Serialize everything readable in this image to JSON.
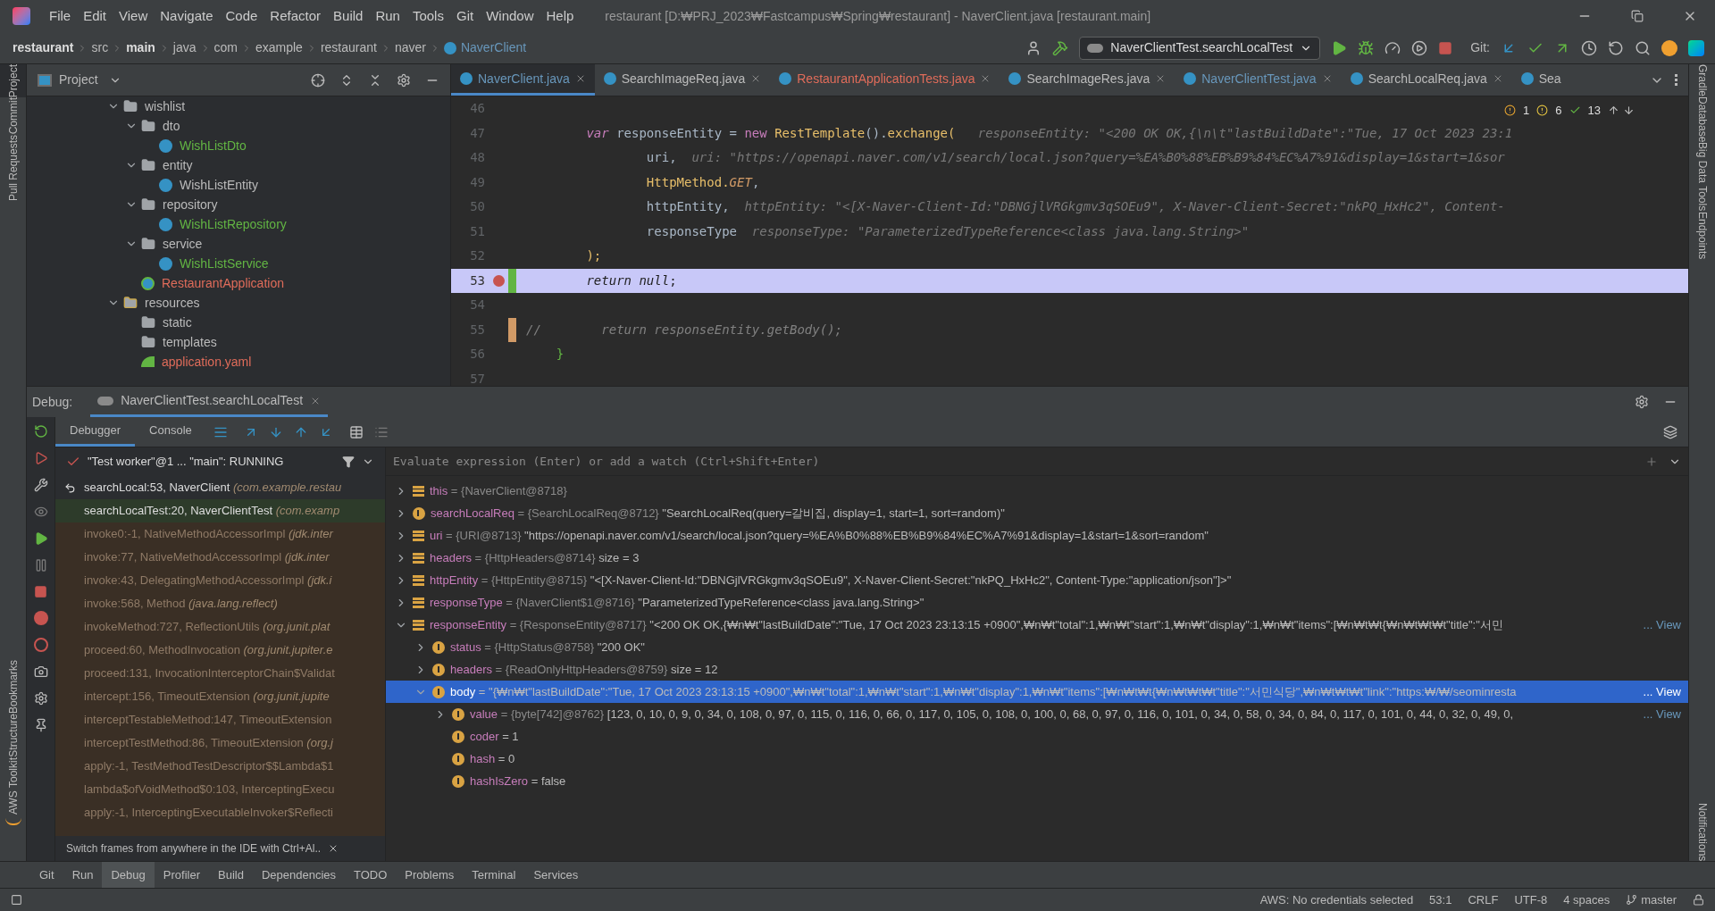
{
  "window": {
    "title": "restaurant [D:₩PRJ_2023₩Fastcampus₩Spring₩restaurant] - NaverClient.java [restaurant.main]"
  },
  "menu": [
    "File",
    "Edit",
    "View",
    "Navigate",
    "Code",
    "Refactor",
    "Build",
    "Run",
    "Tools",
    "Git",
    "Window",
    "Help"
  ],
  "breadcrumbs": [
    {
      "label": "restaurant",
      "bold": true
    },
    {
      "label": "src",
      "bold": false
    },
    {
      "label": "main",
      "bold": true
    },
    {
      "label": "java",
      "bold": false
    },
    {
      "label": "com",
      "bold": false
    },
    {
      "label": "example",
      "bold": false
    },
    {
      "label": "restaurant",
      "bold": false
    },
    {
      "label": "naver",
      "bold": false
    },
    {
      "label": "NaverClient",
      "bold": false,
      "kind": "class"
    }
  ],
  "run_config": "NaverClientTest.searchLocalTest",
  "git_label": "Git:",
  "left_strip": [
    "Project",
    "Commit",
    "Pull Requests",
    "Bookmarks",
    "Structure",
    "AWS Toolkit"
  ],
  "right_strip": [
    "Gradle",
    "Database",
    "Big Data Tools",
    "Endpoints",
    "Notifications"
  ],
  "project_panel": {
    "title": "Project",
    "tree": [
      {
        "name": "wishlist",
        "kind": "folder",
        "expanded": true,
        "children": [
          {
            "name": "dto",
            "kind": "package",
            "expanded": true,
            "children": [
              {
                "name": "WishListDto",
                "kind": "class",
                "color": "#62b543"
              }
            ]
          },
          {
            "name": "entity",
            "kind": "package",
            "expanded": true,
            "children": [
              {
                "name": "WishListEntity",
                "kind": "class",
                "color": "#bbbbbb"
              }
            ]
          },
          {
            "name": "repository",
            "kind": "package",
            "expanded": true,
            "children": [
              {
                "name": "WishListRepository",
                "kind": "class",
                "color": "#62b543"
              }
            ]
          },
          {
            "name": "service",
            "kind": "package",
            "expanded": true,
            "children": [
              {
                "name": "WishListService",
                "kind": "class",
                "color": "#62b543"
              }
            ]
          },
          {
            "name": "RestaurantApplication",
            "kind": "app",
            "color": "#e06c5a"
          }
        ]
      },
      {
        "name": "resources",
        "kind": "resources",
        "expanded": true,
        "children": [
          {
            "name": "static",
            "kind": "folder",
            "color": "#bbbbbb"
          },
          {
            "name": "templates",
            "kind": "folder",
            "color": "#bbbbbb"
          },
          {
            "name": "application.yaml",
            "kind": "yaml",
            "color": "#e06c5a"
          }
        ]
      }
    ]
  },
  "editor_tabs": [
    {
      "label": "NaverClient.java",
      "selected": true,
      "color": "#6897bb"
    },
    {
      "label": "SearchImageReq.java",
      "selected": false,
      "color": "#bbbbbb"
    },
    {
      "label": "RestaurantApplicationTests.java",
      "selected": false,
      "color": "#e06c5a"
    },
    {
      "label": "SearchImageRes.java",
      "selected": false,
      "color": "#bbbbbb"
    },
    {
      "label": "NaverClientTest.java",
      "selected": false,
      "color": "#6897bb"
    },
    {
      "label": "SearchLocalReq.java",
      "selected": false,
      "color": "#bbbbbb"
    },
    {
      "label": "Sea",
      "selected": false,
      "color": "#bbbbbb"
    }
  ],
  "inspections": {
    "errors": "1",
    "warnings": "6",
    "ok": "13"
  },
  "code": [
    {
      "number": "46",
      "current": false
    },
    {
      "number": "47",
      "current": false,
      "segments": [
        {
          "t": "        var",
          "kind": "kw"
        },
        {
          "t": " responseEntity = ",
          "kind": "plain"
        },
        {
          "t": "new ",
          "kind": "kw2"
        },
        {
          "t": "RestTemplate",
          "kind": "cls"
        },
        {
          "t": "().",
          "kind": "plain"
        },
        {
          "t": "exchange(",
          "kind": "method"
        },
        {
          "t": "   responseEntity: \"<200 OK OK,{\\n\\t\"lastBuildDate\":\"Tue, 17 Oct 2023 23:1",
          "kind": "hint"
        }
      ]
    },
    {
      "number": "48",
      "current": false,
      "segments": [
        {
          "t": "                uri,",
          "kind": "plain"
        },
        {
          "t": "  uri: \"https://openapi.naver.com/v1/search/local.json?query=%EA%B0%88%EB%B9%84%EC%A7%91&display=1&start=1&sor",
          "kind": "hint"
        }
      ]
    },
    {
      "number": "49",
      "current": false,
      "segments": [
        {
          "t": "                HttpMethod.",
          "kind": "cls"
        },
        {
          "t": "GET",
          "kind": "enum"
        },
        {
          "t": ",",
          "kind": "plain"
        }
      ]
    },
    {
      "number": "50",
      "current": false,
      "segments": [
        {
          "t": "                httpEntity,",
          "kind": "plain"
        },
        {
          "t": "  httpEntity: \"<[X-Naver-Client-Id:\"DBNGjlVRGkgmv3qSOEu9\", X-Naver-Client-Secret:\"nkPQ_HxHc2\", Content-",
          "kind": "hint"
        }
      ]
    },
    {
      "number": "51",
      "current": false,
      "segments": [
        {
          "t": "                responseType",
          "kind": "plain"
        },
        {
          "t": "  responseType: \"ParameterizedTypeReference<class java.lang.String>\"",
          "kind": "hint"
        }
      ]
    },
    {
      "number": "52",
      "current": false,
      "segments": [
        {
          "t": "        );",
          "kind": "method"
        }
      ]
    },
    {
      "number": "53",
      "current": true,
      "breakpoint": true,
      "color": "#62b543",
      "segments": [
        {
          "t": "        return null",
          "kind": "kw"
        },
        {
          "t": ";",
          "kind": "plain"
        }
      ]
    },
    {
      "number": "54",
      "current": false
    },
    {
      "number": "55",
      "current": false,
      "color": "#d19a66",
      "segments": [
        {
          "t": "//        return responseEntity.getBody();",
          "kind": "comment"
        }
      ]
    },
    {
      "number": "56",
      "current": false,
      "segments": [
        {
          "t": "    }",
          "kind": "brace"
        }
      ]
    },
    {
      "number": "57",
      "current": false
    }
  ],
  "debug": {
    "title": "Debug:",
    "session": "NaverClientTest.searchLocalTest",
    "tabs": [
      {
        "label": "Debugger",
        "selected": true
      },
      {
        "label": "Console",
        "selected": false
      }
    ],
    "thread": "\"Test worker\"@1 ... \"main\": RUNNING",
    "frames": [
      {
        "method": "searchLocal:53, NaverClient",
        "package": "(com.example.restau",
        "kind": "current"
      },
      {
        "method": "searchLocalTest:20, NaverClientTest",
        "package": "(com.examp",
        "kind": "selected"
      },
      {
        "method": "invoke0:-1, NativeMethodAccessorImpl",
        "package": "(jdk.inter",
        "kind": "library"
      },
      {
        "method": "invoke:77, NativeMethodAccessorImpl",
        "package": "(jdk.inter",
        "kind": "library"
      },
      {
        "method": "invoke:43, DelegatingMethodAccessorImpl",
        "package": "(jdk.i",
        "kind": "library"
      },
      {
        "method": "invoke:568, Method",
        "package": "(java.lang.reflect)",
        "kind": "library"
      },
      {
        "method": "invokeMethod:727, ReflectionUtils",
        "package": "(org.junit.plat",
        "kind": "library"
      },
      {
        "method": "proceed:60, MethodInvocation",
        "package": "(org.junit.jupiter.e",
        "kind": "library"
      },
      {
        "method": "proceed:131, InvocationInterceptorChain$Validat",
        "kind": "library"
      },
      {
        "method": "intercept:156, TimeoutExtension",
        "package": "(org.junit.jupite",
        "kind": "library"
      },
      {
        "method": "interceptTestableMethod:147, TimeoutExtension",
        "kind": "library"
      },
      {
        "method": "interceptTestMethod:86, TimeoutExtension",
        "package": "(org.j",
        "kind": "library"
      },
      {
        "method": "apply:-1, TestMethodTestDescriptor$$Lambda$1",
        "kind": "library"
      },
      {
        "method": "lambda$ofVoidMethod$0:103, InterceptingExecu",
        "kind": "library"
      },
      {
        "method": "apply:-1, InterceptingExecutableInvoker$Reflecti",
        "kind": "library"
      }
    ],
    "hint": "Switch frames from anywhere in the IDE with Ctrl+Al..",
    "evaluate_placeholder": "Evaluate expression (Enter) or add a watch (Ctrl+Shift+Enter)",
    "variables": [
      {
        "kind": "local",
        "name": "this",
        "type": "= {NaverClient@8718}",
        "expanded": false,
        "selected": false
      },
      {
        "kind": "param",
        "name": "searchLocalReq",
        "type": "= {SearchLocalReq@8712}",
        "value": "\"SearchLocalReq(query=갈비집, display=1, start=1, sort=random)\"",
        "expanded": false,
        "selected": false
      },
      {
        "kind": "local",
        "name": "uri",
        "type": "= {URI@8713}",
        "value": "\"https://openapi.naver.com/v1/search/local.json?query=%EA%B0%88%EB%B9%84%EC%A7%91&display=1&start=1&sort=random\"",
        "expanded": false,
        "selected": false
      },
      {
        "kind": "local",
        "name": "headers",
        "type": "= {HttpHeaders@8714}",
        "extra": "size = 3",
        "expanded": false,
        "selected": false
      },
      {
        "kind": "local",
        "name": "httpEntity",
        "type": "= {HttpEntity@8715}",
        "value": "\"<[X-Naver-Client-Id:\"DBNGjlVRGkgmv3qSOEu9\", X-Naver-Client-Secret:\"nkPQ_HxHc2\", Content-Type:\"application/json\"]>\"",
        "expanded": false,
        "selected": false
      },
      {
        "kind": "local",
        "name": "responseType",
        "type": "= {NaverClient$1@8716}",
        "value": "\"ParameterizedTypeReference<class java.lang.String>\"",
        "expanded": false,
        "selected": false
      },
      {
        "kind": "local",
        "name": "responseEntity",
        "type": "= {ResponseEntity@8717}",
        "value": "\"<200 OK OK,{₩n₩t\"lastBuildDate\":\"Tue, 17 Oct 2023 23:13:15 +0900\",₩n₩t\"total\":1,₩n₩t\"start\":1,₩n₩t\"display\":1,₩n₩t\"items\":[₩n₩t₩t{₩n₩t₩t₩t\"title\":\"서민",
        "view": "... View",
        "expanded": true,
        "selected": false,
        "children": [
          {
            "kind": "field",
            "name": "status",
            "type": "= {HttpStatus@8758}",
            "value": "\"200 OK\"",
            "expanded": false,
            "selected": false
          },
          {
            "kind": "field",
            "name": "headers",
            "type": "= {ReadOnlyHttpHeaders@8759}",
            "extra": "size = 12",
            "expanded": false,
            "selected": false
          },
          {
            "kind": "field",
            "name": "body",
            "value": "= \"{₩n₩t\"lastBuildDate\":\"Tue, 17 Oct 2023 23:13:15 +0900\",₩n₩t\"total\":1,₩n₩t\"start\":1,₩n₩t\"display\":1,₩n₩t\"items\":[₩n₩t₩t{₩n₩t₩t₩t\"title\":\"서민식당\",₩n₩t₩t₩t\"link\":\"https:₩/₩/seominresta",
            "view": "... View",
            "expanded": true,
            "selected": true,
            "children": [
              {
                "kind": "field",
                "name": "value",
                "type": "= {byte[742]@8762}",
                "value": "[123, 0, 10, 0, 9, 0, 34, 0, 108, 0, 97, 0, 115, 0, 116, 0, 66, 0, 117, 0, 105, 0, 108, 0, 100, 0, 68, 0, 97, 0, 116, 0, 101, 0, 34, 0, 58, 0, 34, 0, 84, 0, 117, 0, 101, 0, 44, 0, 32, 0, 49, 0,",
                "view": "... View",
                "expanded": false,
                "selected": false
              },
              {
                "kind": "field",
                "name": "coder",
                "value": "= 1",
                "selected": false
              },
              {
                "kind": "field",
                "name": "hash",
                "value": "= 0",
                "selected": false
              },
              {
                "kind": "field",
                "name": "hashIsZero",
                "value": "= false",
                "selected": false
              }
            ]
          }
        ]
      }
    ]
  },
  "bottom_tabs": [
    {
      "label": "Git",
      "selected": false
    },
    {
      "label": "Run",
      "selected": false
    },
    {
      "label": "Debug",
      "selected": true
    },
    {
      "label": "Profiler",
      "selected": false
    },
    {
      "label": "Build",
      "selected": false
    },
    {
      "label": "Dependencies",
      "selected": false
    },
    {
      "label": "TODO",
      "selected": false
    },
    {
      "label": "Problems",
      "selected": false
    },
    {
      "label": "Terminal",
      "selected": false
    },
    {
      "label": "Services",
      "selected": false
    }
  ],
  "status_bar": {
    "aws": "AWS: No credentials selected",
    "position": "53:1",
    "line_ending": "CRLF",
    "encoding": "UTF-8",
    "indent": "4 spaces",
    "branch": "master"
  }
}
